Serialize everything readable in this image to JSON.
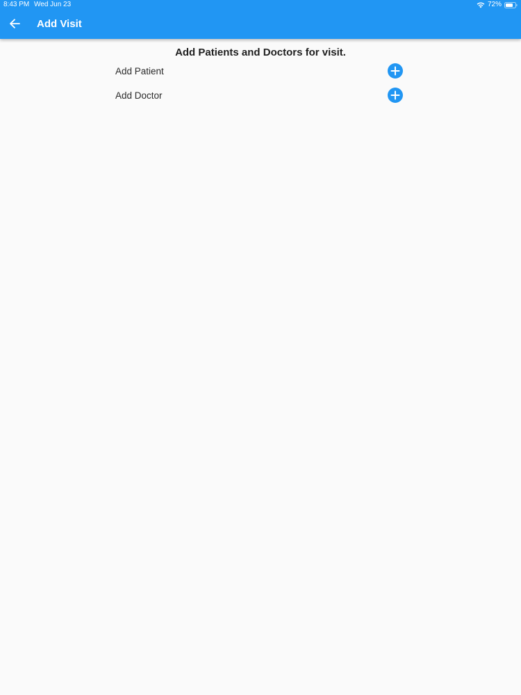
{
  "status_bar": {
    "time": "8:43 PM",
    "date": "Wed Jun 23",
    "battery": "72%"
  },
  "app_bar": {
    "title": "Add Visit",
    "back_icon": "arrow-left-icon"
  },
  "content": {
    "heading": "Add Patients and Doctors for visit.",
    "rows": [
      {
        "label": "Add Patient",
        "icon": "plus-circle-icon"
      },
      {
        "label": "Add Doctor",
        "icon": "plus-circle-icon"
      }
    ]
  },
  "colors": {
    "primary": "#2196f3",
    "background": "#fafafa"
  }
}
